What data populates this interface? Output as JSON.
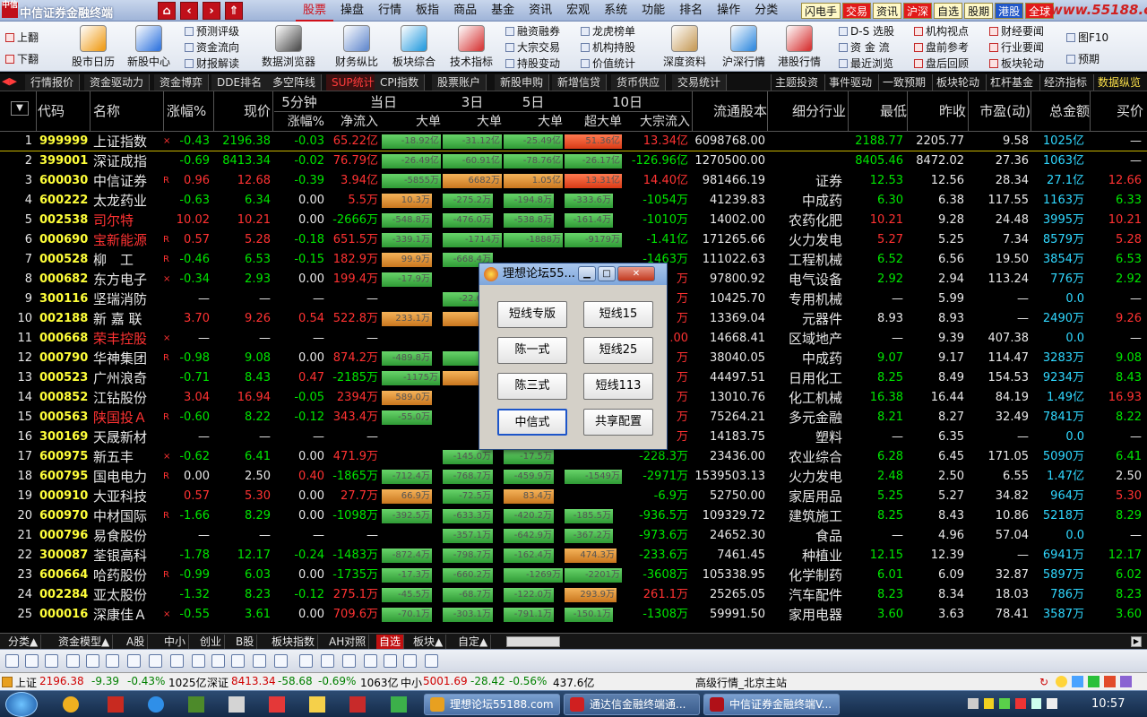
{
  "window": {
    "title": "中信证券金融终端",
    "logo_text": "中信"
  },
  "nav_buttons": [
    "⌂",
    "‹",
    "›",
    "⇑"
  ],
  "main_menu": [
    "股票",
    "操盘",
    "行情",
    "板指",
    "商品",
    "基金",
    "资讯",
    "宏观",
    "系统",
    "功能",
    "排名",
    "操作",
    "分类"
  ],
  "quick_menu": [
    "闪电手",
    "交易",
    "资讯",
    "沪深",
    "自选",
    "股期",
    "港股",
    "全球"
  ],
  "watermark": "www.55188.com",
  "toolbar": {
    "updown": [
      "上翻",
      "下翻"
    ],
    "big_buttons": [
      "股市日历",
      "新股中心",
      "数据浏览器",
      "财务纵比",
      "板块综合",
      "技术指标",
      "深度资料",
      "沪深行情",
      "港股行情"
    ],
    "small_col1": [
      "预测评级",
      "资金流向",
      "财报解读"
    ],
    "small_col2": [
      "融资融券",
      "大宗交易",
      "持股变动"
    ],
    "small_col3": [
      "龙虎榜单",
      "机构持股",
      "价值统计"
    ],
    "small_col4": [
      "D-S 选股",
      "资 金 流",
      "最近浏览"
    ],
    "small_col5": [
      "机构视点",
      "盘前参考",
      "盘后回顾"
    ],
    "small_col6": [
      "财经要闻",
      "行业要闻",
      "板块轮动"
    ],
    "small_col7": [
      "图F10",
      "预期"
    ]
  },
  "tabs_left": [
    "行情报价",
    "资金驱动力",
    "资金博弈",
    "DDE排名",
    "多空阵线",
    "SUP统计",
    "CPI指数",
    "股票账户",
    "新股申购",
    "新增信贷",
    "货币供应",
    "交易统计"
  ],
  "active_tab": "SUP统计",
  "tabs_right": [
    "主题投资",
    "事件驱动",
    "一致预期",
    "板块轮动",
    "杠杆基金",
    "经济指标",
    "数据纵览"
  ],
  "header": {
    "groups": [
      "5分钟",
      "当日",
      "3日",
      "5日",
      "10日"
    ],
    "cols": [
      "代码",
      "名称",
      "涨幅%",
      "现价",
      "涨幅%",
      "净流入",
      "大单",
      "大单",
      "大单",
      "超大单",
      "大宗流入",
      "流通股本",
      "细分行业",
      "最低",
      "昨收",
      "市盈(动)",
      "总金额",
      "买价"
    ]
  },
  "rows": [
    {
      "n": "1",
      "code": "999999",
      "name": "上证指数",
      "mk": "×",
      "chg": "-0.43",
      "price": "2196.38",
      "c5": "-0.03",
      "net": "65.22亿",
      "b1": "-18.92亿",
      "b3": "-31.12亿",
      "b5": "-25.49亿",
      "b10": "51.36亿",
      "bulk": "13.34亿",
      "float": "6098768.00",
      "ind": "",
      "low": "2188.77",
      "prev": "2205.77",
      "pe": "9.58",
      "amt": "1025亿",
      "bid": "—"
    },
    {
      "n": "2",
      "code": "399001",
      "name": "深证成指",
      "mk": "",
      "chg": "-0.69",
      "price": "8413.34",
      "c5": "-0.02",
      "net": "76.79亿",
      "b1": "-26.49亿",
      "b3": "-60.91亿",
      "b5": "-78.76亿",
      "b10": "-26.17亿",
      "bulk": "-126.96亿",
      "float": "1270500.00",
      "ind": "",
      "low": "8405.46",
      "prev": "8472.02",
      "pe": "27.36",
      "amt": "1063亿",
      "bid": "—"
    },
    {
      "n": "3",
      "code": "600030",
      "name": "中信证券",
      "mk": "R",
      "chg": "0.96",
      "price": "12.68",
      "c5": "-0.39",
      "net": "3.94亿",
      "b1": "-5855万",
      "b3": "6682万",
      "b5": "1.05亿",
      "b10": "13.31亿",
      "bulk": "14.40亿",
      "float": "981466.19",
      "ind": "证券",
      "low": "12.53",
      "prev": "12.56",
      "pe": "28.34",
      "amt": "27.1亿",
      "bid": "12.66"
    },
    {
      "n": "4",
      "code": "600222",
      "name": "太龙药业",
      "mk": "",
      "chg": "-0.63",
      "price": "6.34",
      "c5": "0.00",
      "net": "5.5万",
      "b1": "10.3万",
      "b3": "-275.2万",
      "b5": "-194.8万",
      "b10": "-333.6万",
      "bulk": "-1054万",
      "float": "41239.83",
      "ind": "中成药",
      "low": "6.30",
      "prev": "6.38",
      "pe": "117.55",
      "amt": "1163万",
      "bid": "6.33"
    },
    {
      "n": "5",
      "code": "002538",
      "name": "司尔特",
      "mk": "",
      "chg": "10.02",
      "price": "10.21",
      "c5": "0.00",
      "net": "-2666万",
      "b1": "-548.8万",
      "b3": "-476.0万",
      "b5": "-538.8万",
      "b10": "-161.4万",
      "bulk": "-1010万",
      "float": "14002.00",
      "ind": "农药化肥",
      "low": "10.21",
      "prev": "9.28",
      "pe": "24.48",
      "amt": "3995万",
      "bid": "10.21"
    },
    {
      "n": "6",
      "code": "000690",
      "name": "宝新能源",
      "mk": "R",
      "chg": "0.57",
      "price": "5.28",
      "c5": "-0.18",
      "net": "651.5万",
      "b1": "-339.1万",
      "b3": "-1714万",
      "b5": "-1888万",
      "b10": "-9179万",
      "bulk": "-1.41亿",
      "float": "171265.66",
      "ind": "火力发电",
      "low": "5.27",
      "prev": "5.25",
      "pe": "7.34",
      "amt": "8579万",
      "bid": "5.28"
    },
    {
      "n": "7",
      "code": "000528",
      "name": "柳　工",
      "mk": "R",
      "chg": "-0.46",
      "price": "6.53",
      "c5": "-0.15",
      "net": "182.9万",
      "b1": "99.9万",
      "b3": "-668.4万",
      "b5": "",
      "b10": "",
      "bulk": "-1463万",
      "float": "111022.63",
      "ind": "工程机械",
      "low": "6.52",
      "prev": "6.56",
      "pe": "19.50",
      "amt": "3854万",
      "bid": "6.53"
    },
    {
      "n": "8",
      "code": "000682",
      "name": "东方电子",
      "mk": "×",
      "chg": "-0.34",
      "price": "2.93",
      "c5": "0.00",
      "net": "199.4万",
      "b1": "-17.9万",
      "b3": "",
      "b5": "",
      "b10": "",
      "bulk": "万",
      "float": "97800.92",
      "ind": "电气设备",
      "low": "2.92",
      "prev": "2.94",
      "pe": "113.24",
      "amt": "776万",
      "bid": "2.92"
    },
    {
      "n": "9",
      "code": "300116",
      "name": "坚瑞消防",
      "mk": "",
      "chg": "—",
      "price": "—",
      "c5": "—",
      "net": "—",
      "b1": "",
      "b3": "-22.6万",
      "b5": "",
      "b10": "",
      "bulk": "万",
      "float": "10425.70",
      "ind": "专用机械",
      "low": "—",
      "prev": "5.99",
      "pe": "—",
      "amt": "0.0",
      "bid": "—"
    },
    {
      "n": "10",
      "code": "002188",
      "name": "新 嘉 联",
      "mk": "",
      "chg": "3.70",
      "price": "9.26",
      "c5": "0.54",
      "net": "522.8万",
      "b1": "233.1万",
      "b3": "7",
      "b5": "",
      "b10": "",
      "bulk": "万",
      "float": "13369.04",
      "ind": "元器件",
      "low": "8.93",
      "prev": "8.93",
      "pe": "—",
      "amt": "2490万",
      "bid": "9.26"
    },
    {
      "n": "11",
      "code": "000668",
      "name": "荣丰控股",
      "mk": "×",
      "chg": "—",
      "price": "—",
      "c5": "—",
      "net": "—",
      "b1": "",
      "b3": "",
      "b5": "",
      "b10": "",
      "bulk": ".00",
      "float": "14668.41",
      "ind": "区域地产",
      "low": "—",
      "prev": "9.39",
      "pe": "407.38",
      "amt": "0.0",
      "bid": "—"
    },
    {
      "n": "12",
      "code": "000790",
      "name": "华神集团",
      "mk": "R",
      "chg": "-0.98",
      "price": "9.08",
      "c5": "0.00",
      "net": "874.2万",
      "b1": "-489.8万",
      "b3": "-1",
      "b5": "",
      "b10": "",
      "bulk": "万",
      "float": "38040.05",
      "ind": "中成药",
      "low": "9.07",
      "prev": "9.17",
      "pe": "114.47",
      "amt": "3283万",
      "bid": "9.08"
    },
    {
      "n": "13",
      "code": "000523",
      "name": "广州浪奇",
      "mk": "",
      "chg": "-0.71",
      "price": "8.43",
      "c5": "0.47",
      "net": "-2185万",
      "b1": "-1175万",
      "b3": "16",
      "b5": "",
      "b10": "",
      "bulk": "万",
      "float": "44497.51",
      "ind": "日用化工",
      "low": "8.25",
      "prev": "8.49",
      "pe": "154.53",
      "amt": "9234万",
      "bid": "8.43"
    },
    {
      "n": "14",
      "code": "000852",
      "name": "江钻股份",
      "mk": "",
      "chg": "3.04",
      "price": "16.94",
      "c5": "-0.05",
      "net": "2394万",
      "b1": "589.0万",
      "b3": "",
      "b5": "",
      "b10": "",
      "bulk": "万",
      "float": "13010.76",
      "ind": "化工机械",
      "low": "16.38",
      "prev": "16.44",
      "pe": "84.19",
      "amt": "1.49亿",
      "bid": "16.93"
    },
    {
      "n": "15",
      "code": "000563",
      "name": "陕国投Ａ",
      "mk": "R",
      "chg": "-0.60",
      "price": "8.22",
      "c5": "-0.12",
      "net": "343.4万",
      "b1": "-55.0万",
      "b3": "",
      "b5": "",
      "b10": "",
      "bulk": "万",
      "float": "75264.21",
      "ind": "多元金融",
      "low": "8.21",
      "prev": "8.27",
      "pe": "32.49",
      "amt": "7841万",
      "bid": "8.22"
    },
    {
      "n": "16",
      "code": "300169",
      "name": "天晟新材",
      "mk": "",
      "chg": "—",
      "price": "—",
      "c5": "—",
      "net": "—",
      "b1": "",
      "b3": "",
      "b5": "",
      "b10": "",
      "bulk": "万",
      "float": "14183.75",
      "ind": "塑料",
      "low": "—",
      "prev": "6.35",
      "pe": "—",
      "amt": "0.0",
      "bid": "—"
    },
    {
      "n": "17",
      "code": "600975",
      "name": "新五丰",
      "mk": "×",
      "chg": "-0.62",
      "price": "6.41",
      "c5": "0.00",
      "net": "471.9万",
      "b1": "",
      "b3": "-145.0万",
      "b5": "-17.5万",
      "b10": "",
      "bulk": "-228.3万",
      "float": "23436.00",
      "ind": "农业综合",
      "low": "6.28",
      "prev": "6.45",
      "pe": "171.05",
      "amt": "5090万",
      "bid": "6.41"
    },
    {
      "n": "18",
      "code": "600795",
      "name": "国电电力",
      "mk": "R",
      "chg": "0.00",
      "price": "2.50",
      "c5": "0.40",
      "net": "-1865万",
      "b1": "-712.4万",
      "b3": "-768.7万",
      "b5": "-459.9万",
      "b10": "-1549万",
      "bulk": "-2971万",
      "float": "1539503.13",
      "ind": "火力发电",
      "low": "2.48",
      "prev": "2.50",
      "pe": "6.55",
      "amt": "1.47亿",
      "bid": "2.50"
    },
    {
      "n": "19",
      "code": "000910",
      "name": "大亚科技",
      "mk": "",
      "chg": "0.57",
      "price": "5.30",
      "c5": "0.00",
      "net": "27.7万",
      "b1": "66.9万",
      "b3": "-72.5万",
      "b5": "83.4万",
      "b10": "",
      "bulk": "-6.9万",
      "float": "52750.00",
      "ind": "家居用品",
      "low": "5.25",
      "prev": "5.27",
      "pe": "34.82",
      "amt": "964万",
      "bid": "5.30"
    },
    {
      "n": "20",
      "code": "600970",
      "name": "中材国际",
      "mk": "R",
      "chg": "-1.66",
      "price": "8.29",
      "c5": "0.00",
      "net": "-1098万",
      "b1": "-392.5万",
      "b3": "-633.3万",
      "b5": "-420.2万",
      "b10": "-185.5万",
      "bulk": "-936.5万",
      "float": "109329.72",
      "ind": "建筑施工",
      "low": "8.25",
      "prev": "8.43",
      "pe": "10.86",
      "amt": "5218万",
      "bid": "8.29"
    },
    {
      "n": "21",
      "code": "000796",
      "name": "易食股份",
      "mk": "",
      "chg": "—",
      "price": "—",
      "c5": "—",
      "net": "—",
      "b1": "",
      "b3": "-357.1万",
      "b5": "-642.9万",
      "b10": "-367.2万",
      "bulk": "-973.6万",
      "float": "24652.30",
      "ind": "食品",
      "low": "—",
      "prev": "4.96",
      "pe": "57.04",
      "amt": "0.0",
      "bid": "—"
    },
    {
      "n": "22",
      "code": "300087",
      "name": "荃银高科",
      "mk": "",
      "chg": "-1.78",
      "price": "12.17",
      "c5": "-0.24",
      "net": "-1483万",
      "b1": "-872.4万",
      "b3": "-798.7万",
      "b5": "-162.4万",
      "b10": "474.3万",
      "bulk": "-233.6万",
      "float": "7461.45",
      "ind": "种植业",
      "low": "12.15",
      "prev": "12.39",
      "pe": "—",
      "amt": "6941万",
      "bid": "12.17"
    },
    {
      "n": "23",
      "code": "600664",
      "name": "哈药股份",
      "mk": "R",
      "chg": "-0.99",
      "price": "6.03",
      "c5": "0.00",
      "net": "-1735万",
      "b1": "-17.3万",
      "b3": "-660.2万",
      "b5": "-1269万",
      "b10": "-2201万",
      "bulk": "-3608万",
      "float": "105338.95",
      "ind": "化学制药",
      "low": "6.01",
      "prev": "6.09",
      "pe": "32.87",
      "amt": "5897万",
      "bid": "6.02"
    },
    {
      "n": "24",
      "code": "002284",
      "name": "亚太股份",
      "mk": "",
      "chg": "-1.32",
      "price": "8.23",
      "c5": "-0.12",
      "net": "275.1万",
      "b1": "-45.5万",
      "b3": "-68.7万",
      "b5": "-122.0万",
      "b10": "293.9万",
      "bulk": "261.1万",
      "float": "25265.05",
      "ind": "汽车配件",
      "low": "8.23",
      "prev": "8.34",
      "pe": "18.03",
      "amt": "786万",
      "bid": "8.23"
    },
    {
      "n": "25",
      "code": "000016",
      "name": "深康佳Ａ",
      "mk": "×",
      "chg": "-0.55",
      "price": "3.61",
      "c5": "0.00",
      "net": "709.6万",
      "b1": "-70.1万",
      "b3": "-303.1万",
      "b5": "-791.1万",
      "b10": "-150.1万",
      "bulk": "-1308万",
      "float": "59991.50",
      "ind": "家用电器",
      "low": "3.60",
      "prev": "3.63",
      "pe": "78.41",
      "amt": "3587万",
      "bid": "3.60"
    }
  ],
  "dialog": {
    "title": "理想论坛55...",
    "buttons": [
      "短线专版",
      "短线15",
      "陈一式",
      "短线25",
      "陈三式",
      "短线113",
      "中信式",
      "共享配置"
    ]
  },
  "sheet_tabs": [
    "分类▲",
    "资金模型▲",
    "A股",
    "中小",
    "创业",
    "B股",
    "板块指数",
    "AH对照",
    "自选",
    "板块▲",
    "自定▲"
  ],
  "active_sheet": "自选",
  "status": {
    "sh_label": "上证",
    "sh_val": "2196.38",
    "sh_chg": "-9.39",
    "sh_pct": "-0.43%",
    "sh_amt": "1025亿",
    "sz_label": "深证",
    "sz_val": "8413.34",
    "sz_chg": "-58.68",
    "sz_pct": "-0.69%",
    "sz_amt": "1063亿",
    "zx_label": "中小",
    "zx_val": "5001.69",
    "zx_chg": "-28.42",
    "zx_pct": "-0.56%",
    "zx_amt": "437.6亿",
    "server": "高级行情_北京主站"
  },
  "taskbar": {
    "items": [
      "理想论坛55188.com",
      "通达信金融终端通...",
      "中信证券金融终端V..."
    ],
    "clock": "10:57"
  },
  "colors": {
    "up": "#ff3232",
    "down": "#00e600",
    "code": "#ffff3a",
    "amount": "#30d8ff"
  }
}
